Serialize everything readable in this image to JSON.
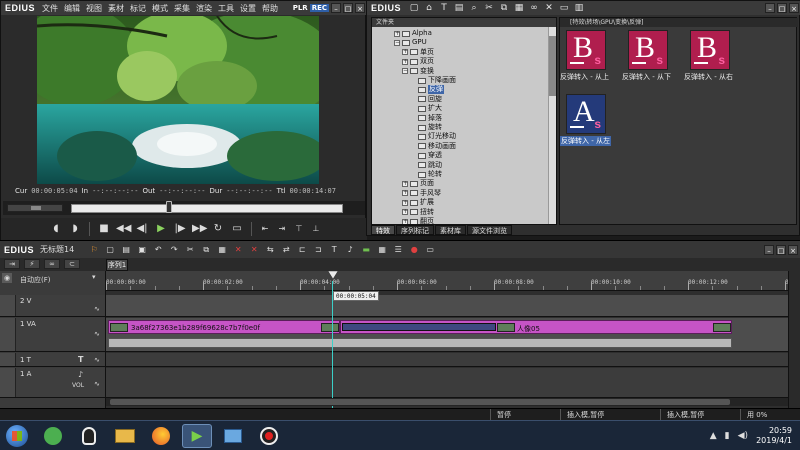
{
  "preview": {
    "logo": "EDIUS",
    "menu": [
      "文件",
      "编辑",
      "视图",
      "素材",
      "标记",
      "模式",
      "采集",
      "渲染",
      "工具",
      "设置",
      "帮助"
    ],
    "plr_label": "PLR",
    "rec_label": "REC",
    "timecodes": {
      "cur_label": "Cur",
      "cur_value": "00:00:05:04",
      "in_label": "In",
      "in_value": "--:--:--:--",
      "out_label": "Out",
      "out_value": "--:--:--:--",
      "dur_label": "Dur",
      "dur_value": "--:--:--:--",
      "ttl_label": "Ttl",
      "ttl_value": "00:00:14:07"
    },
    "scrub_position": 0.36
  },
  "bin": {
    "logo": "EDIUS",
    "tree_header": "文件夹",
    "tree": [
      {
        "indent": 3,
        "label": "Alpha",
        "toggle": "+"
      },
      {
        "indent": 3,
        "label": "GPU",
        "toggle": "−"
      },
      {
        "indent": 4,
        "label": "单页",
        "toggle": "+"
      },
      {
        "indent": 4,
        "label": "双页",
        "toggle": "+"
      },
      {
        "indent": 4,
        "label": "变换",
        "toggle": "−"
      },
      {
        "indent": 5,
        "label": "下降画面"
      },
      {
        "indent": 5,
        "label": "反弹",
        "selected": true
      },
      {
        "indent": 5,
        "label": "回旋"
      },
      {
        "indent": 5,
        "label": "扩大"
      },
      {
        "indent": 5,
        "label": "掉落"
      },
      {
        "indent": 5,
        "label": "旋转"
      },
      {
        "indent": 5,
        "label": "灯光移动"
      },
      {
        "indent": 5,
        "label": "移动画面"
      },
      {
        "indent": 5,
        "label": "穿透"
      },
      {
        "indent": 5,
        "label": "跳动"
      },
      {
        "indent": 5,
        "label": "轮转"
      },
      {
        "indent": 4,
        "label": "页面",
        "toggle": "+"
      },
      {
        "indent": 4,
        "label": "手风琴",
        "toggle": "+"
      },
      {
        "indent": 4,
        "label": "扩展",
        "toggle": "+"
      },
      {
        "indent": 4,
        "label": "扭转",
        "toggle": "+"
      },
      {
        "indent": 4,
        "label": "翻页",
        "toggle": "+"
      }
    ],
    "path": "[特效\\转场\\GPU\\变换\\反弹]",
    "effects": [
      {
        "letter": "B",
        "sub": "s",
        "label": "反弹转入 - 从上",
        "color": "red"
      },
      {
        "letter": "B",
        "sub": "s",
        "label": "反弹转入 - 从下",
        "color": "red"
      },
      {
        "letter": "B",
        "sub": "s",
        "label": "反弹转入 - 从右",
        "color": "red"
      },
      {
        "letter": "A",
        "sub": "s",
        "label": "反弹转入 - 从左",
        "color": "blue",
        "selected": true
      }
    ],
    "tabs": [
      "特效",
      "序列标记",
      "素材库",
      "源文件浏览"
    ]
  },
  "timeline": {
    "logo": "EDIUS",
    "project_name": "无标题14",
    "sequence_tab": "序列1",
    "mode_label": "自动应(F)",
    "ruler_labels": [
      "00:00:00:00",
      "00:00:02:00",
      "00:00:04:00",
      "00:00:06:00",
      "00:00:08:00",
      "00:00:10:00",
      "00:00:12:00",
      "00:00:14:00"
    ],
    "playhead_tc": "00:00:05:04",
    "tracks": [
      {
        "name": "2 V",
        "type": "video"
      },
      {
        "name": "1 VA",
        "type": "video-audio"
      },
      {
        "name": "1 T",
        "type": "title"
      },
      {
        "name": "1 A",
        "type": "audio",
        "vol_label": "VOL"
      }
    ],
    "clip1_name": "3a68f27363e1b289f69628c7b7f0e0f",
    "clip2_name": "人像05"
  },
  "status": {
    "cells": [
      "暂停",
      "插入模,暂停",
      "插入模,暂停",
      "用 0%"
    ]
  },
  "taskbar": {
    "time": "20:59",
    "date": "2019/4/1"
  },
  "colors": {
    "clip_magenta": "#c654c6",
    "playhead_cyan": "#3bd0c8",
    "selection_blue": "#3f66a8",
    "effect_red": "#b01e4e",
    "effect_blue": "#243a7a"
  }
}
